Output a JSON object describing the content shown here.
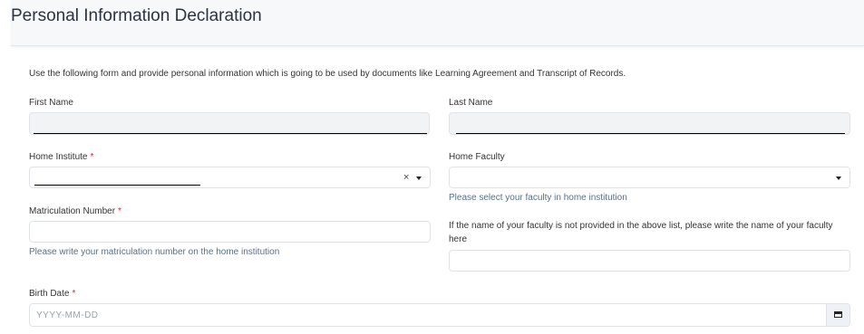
{
  "page": {
    "title": "Personal Information Declaration",
    "intro": "Use the following form and provide personal information which is going to be used by documents like Learning Agreement and Transcript of Records."
  },
  "fields": {
    "first_name": {
      "label": "First Name",
      "value": ""
    },
    "last_name": {
      "label": "Last Name",
      "value": ""
    },
    "home_institute": {
      "label": "Home Institute",
      "required_mark": "*",
      "clear_glyph": "×"
    },
    "home_faculty": {
      "label": "Home Faculty",
      "help": "Please select your faculty in home institution"
    },
    "matriculation_number": {
      "label": "Matriculation Number",
      "required_mark": "*",
      "help": "Please write your matriculation number on the home institution",
      "value": ""
    },
    "faculty_other": {
      "label_line1": "If the name of your faculty is not provided in the above list, please write the name of your faculty",
      "label_line2": "here",
      "value": ""
    },
    "birth_date": {
      "label": "Birth Date",
      "required_mark": "*",
      "placeholder": "YYYY-MM-DD"
    }
  },
  "icons": {
    "clear": "close-icon",
    "dropdown": "chevron-down-icon",
    "calendar": "calendar-icon"
  }
}
